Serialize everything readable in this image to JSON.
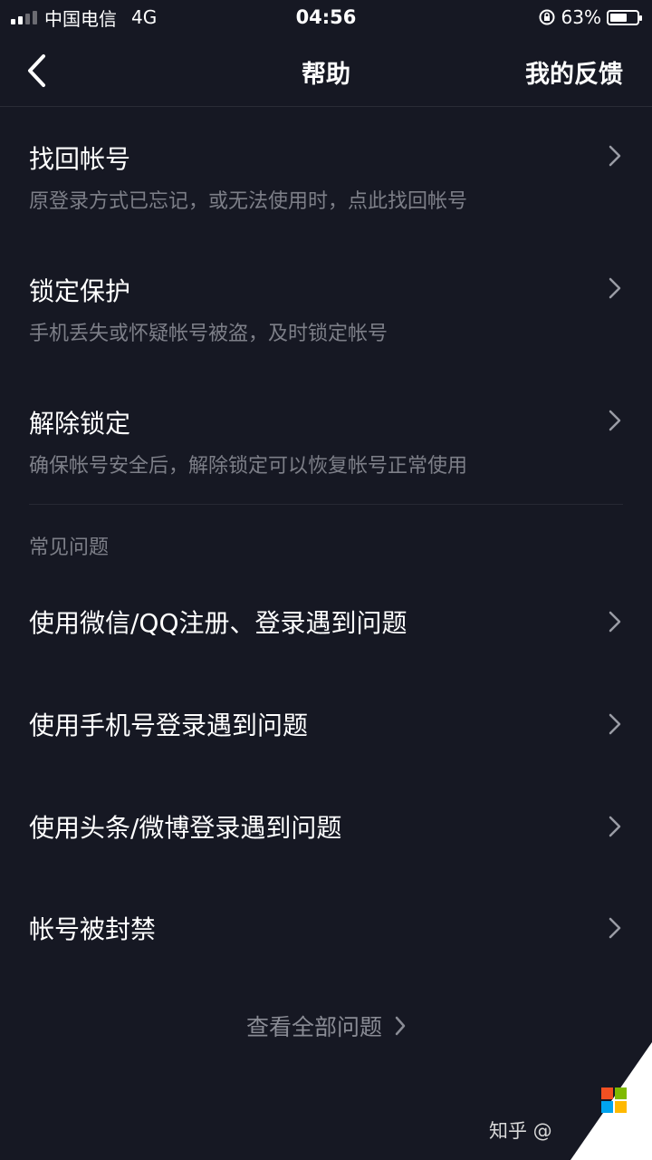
{
  "status_bar": {
    "carrier": "中国电信",
    "network": "4G",
    "time": "04:56",
    "battery": "63%",
    "battery_level": 0.63
  },
  "header": {
    "title": "帮助",
    "feedback_label": "我的反馈"
  },
  "account_items": [
    {
      "title": "找回帐号",
      "desc": "原登录方式已忘记，或无法使用时，点此找回帐号"
    },
    {
      "title": "锁定保护",
      "desc": "手机丢失或怀疑帐号被盗，及时锁定帐号"
    },
    {
      "title": "解除锁定",
      "desc": "确保帐号安全后，解除锁定可以恢复帐号正常使用"
    }
  ],
  "faq": {
    "section_label": "常见问题",
    "items": [
      {
        "title": "使用微信/QQ注册、登录遇到问题"
      },
      {
        "title": "使用手机号登录遇到问题"
      },
      {
        "title": "使用头条/微博登录遇到问题"
      },
      {
        "title": "帐号被封禁"
      }
    ],
    "view_all_label": "查看全部问题"
  },
  "watermark": {
    "text": "知乎 @"
  },
  "colors": {
    "background": "#161823",
    "secondary_text": "#7d7f88"
  }
}
